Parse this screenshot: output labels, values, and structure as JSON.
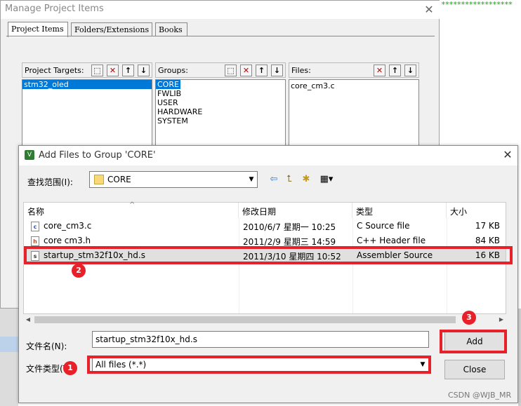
{
  "background_window": {
    "title": "Manage Project Items",
    "close": "✕",
    "tabs": [
      "Project Items",
      "Folders/Extensions",
      "Books"
    ],
    "panels": {
      "targets": {
        "label": "Project Targets:",
        "items": [
          "stm32_oled"
        ]
      },
      "groups": {
        "label": "Groups:",
        "items": [
          "CORE",
          "FWLIB",
          "USER",
          "HARDWARE",
          "SYSTEM"
        ]
      },
      "files": {
        "label": "Files:",
        "items": [
          "core_cm3.c"
        ]
      }
    },
    "stars": "******************"
  },
  "dialog": {
    "title": "Add Files to Group 'CORE'",
    "icon_text": "V",
    "close": "✕",
    "look_in_label": "查找范围(I):",
    "look_in_value": "CORE",
    "columns": {
      "name": "名称",
      "date": "修改日期",
      "type": "类型",
      "size": "大小"
    },
    "files": [
      {
        "icon": "c",
        "name": "core_cm3.c",
        "date": "2010/6/7 星期一 10:25",
        "type": "C Source file",
        "size": "17 KB"
      },
      {
        "icon": "h",
        "name": "core cm3.h",
        "date": "2011/2/9 星期三 14:59",
        "type": "C++ Header file",
        "size": "84 KB"
      },
      {
        "icon": "s",
        "name": "startup_stm32f10x_hd.s",
        "date": "2011/3/10 星期四 10:52",
        "type": "Assembler Source",
        "size": "16 KB"
      }
    ],
    "file_name_label": "文件名(N):",
    "file_name_value": "startup_stm32f10x_hd.s",
    "file_type_label": "文件类型(T):",
    "file_type_value": "All files (*.*)",
    "add_label": "Add",
    "close_label": "Close"
  },
  "annotations": {
    "badge1": "1",
    "badge2": "2",
    "badge3": "3",
    "accent": "#e8202a"
  },
  "watermark": "CSDN @WJB_MR"
}
